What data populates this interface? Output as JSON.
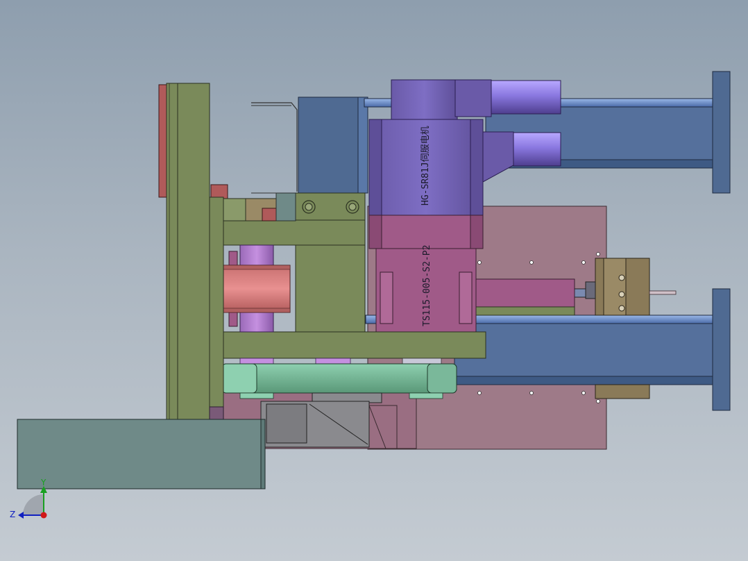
{
  "labels": {
    "motor": "HG-SR81J伺服电机",
    "reducer": "TS115-005-S2-P2"
  },
  "axes": {
    "y": "Y",
    "z": "Z"
  },
  "colors": {
    "background_top": "#8e9eae",
    "background_bottom": "#c4cbd2",
    "olive_frame": "#7a8a5a",
    "servo_motor": "#7a6ab0",
    "reducer": "#a05a88",
    "base_plate": "#9e7a88",
    "cylinder_body": "#4f6a92",
    "cylinder_bar": "#5b7ab0",
    "belt_green": "#6aa888",
    "base_block": "#6f8a88",
    "red_part": "#b05a5a"
  }
}
